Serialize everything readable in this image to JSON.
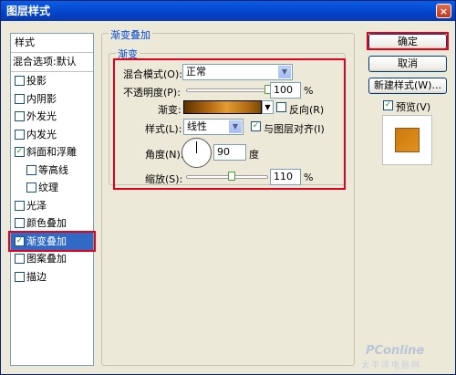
{
  "window": {
    "title": "图层样式",
    "close_glyph": "×"
  },
  "left_panel": {
    "header": "样式",
    "blend_options": "混合选项:默认",
    "items": [
      {
        "label": "投影",
        "checked": false
      },
      {
        "label": "内阴影",
        "checked": false
      },
      {
        "label": "外发光",
        "checked": false
      },
      {
        "label": "内发光",
        "checked": false
      },
      {
        "label": "斜面和浮雕",
        "checked": true
      },
      {
        "label": "等高线",
        "checked": false
      },
      {
        "label": "纹理",
        "checked": false
      },
      {
        "label": "光泽",
        "checked": false
      },
      {
        "label": "颜色叠加",
        "checked": false
      },
      {
        "label": "渐变叠加",
        "checked": true
      },
      {
        "label": "图案叠加",
        "checked": false
      },
      {
        "label": "描边",
        "checked": false
      }
    ]
  },
  "main": {
    "group_title": "渐变叠加",
    "subgroup_title": "渐变",
    "blend_mode_label": "混合模式(O):",
    "blend_mode_value": "正常",
    "opacity_label": "不透明度(P):",
    "opacity_value": "100",
    "opacity_unit": "%",
    "opacity_fraction": 1.0,
    "gradient_label": "渐变:",
    "reverse_label": "反向(R)",
    "reverse_checked": false,
    "style_label": "样式(L):",
    "style_value": "线性",
    "align_label": "与图层对齐(I)",
    "align_checked": true,
    "angle_label": "角度(N):",
    "angle_value": "90",
    "angle_unit": "度",
    "scale_label": "缩放(S):",
    "scale_value": "110",
    "scale_unit": "%",
    "scale_fraction": 0.55
  },
  "buttons": {
    "ok": "确定",
    "cancel": "取消",
    "new_style": "新建样式(W)...",
    "preview_label": "预览(V)",
    "preview_checked": true
  },
  "icons": {
    "checkmark": "✓",
    "dropdown": "▼"
  },
  "watermark": {
    "brand": "PConline",
    "sub": "太平洋电脑网"
  },
  "colors": {
    "accent_red": "#e3001b",
    "selection": "#316ac5",
    "title_blue": "#0443c8",
    "preview_fill": "#d98915"
  }
}
